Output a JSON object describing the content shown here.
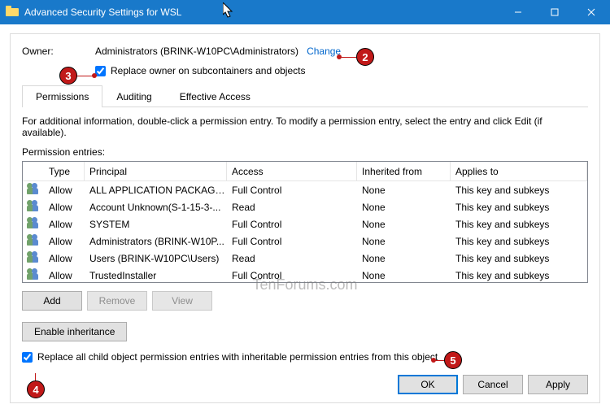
{
  "title": "Advanced Security Settings for WSL",
  "owner": {
    "label": "Owner:",
    "value": "Administrators (BRINK-W10PC\\Administrators)",
    "change_link": "Change",
    "replace_owner_label": "Replace owner on subcontainers and objects"
  },
  "tabs": {
    "permissions": "Permissions",
    "auditing": "Auditing",
    "effective": "Effective Access"
  },
  "info_text": "For additional information, double-click a permission entry. To modify a permission entry, select the entry and click Edit (if available).",
  "entries_label": "Permission entries:",
  "columns": {
    "type": "Type",
    "principal": "Principal",
    "access": "Access",
    "inherited": "Inherited from",
    "applies": "Applies to"
  },
  "rows": [
    {
      "type": "Allow",
      "principal": "ALL APPLICATION PACKAGES",
      "access": "Full Control",
      "inherited": "None",
      "applies": "This key and subkeys"
    },
    {
      "type": "Allow",
      "principal": "Account Unknown(S-1-15-3-...",
      "access": "Read",
      "inherited": "None",
      "applies": "This key and subkeys"
    },
    {
      "type": "Allow",
      "principal": "SYSTEM",
      "access": "Full Control",
      "inherited": "None",
      "applies": "This key and subkeys"
    },
    {
      "type": "Allow",
      "principal": "Administrators (BRINK-W10P...",
      "access": "Full Control",
      "inherited": "None",
      "applies": "This key and subkeys"
    },
    {
      "type": "Allow",
      "principal": "Users (BRINK-W10PC\\Users)",
      "access": "Read",
      "inherited": "None",
      "applies": "This key and subkeys"
    },
    {
      "type": "Allow",
      "principal": "TrustedInstaller",
      "access": "Full Control",
      "inherited": "None",
      "applies": "This key and subkeys"
    }
  ],
  "buttons": {
    "add": "Add",
    "remove": "Remove",
    "view": "View",
    "enable_inheritance": "Enable inheritance",
    "ok": "OK",
    "cancel": "Cancel",
    "apply": "Apply"
  },
  "replace_child_label": "Replace all child object permission entries with inheritable permission entries from this object",
  "callouts": {
    "c2": "2",
    "c3": "3",
    "c4": "4",
    "c5": "5"
  },
  "watermark": "TenForums.com"
}
